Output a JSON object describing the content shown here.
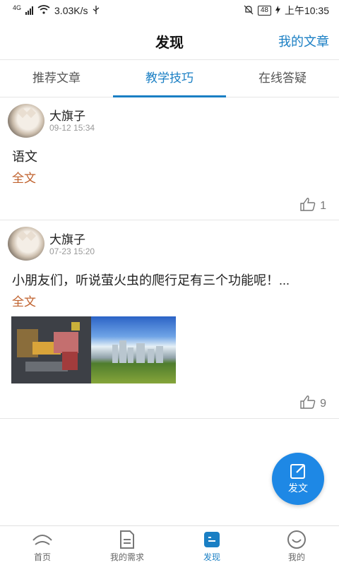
{
  "status_bar": {
    "network": "4G",
    "speed": "3.03K/s",
    "battery": "48",
    "time": "上午10:35"
  },
  "header": {
    "title": "发现",
    "action": "我的文章"
  },
  "tabs": [
    {
      "label": "推荐文章",
      "active": false
    },
    {
      "label": "教学技巧",
      "active": true
    },
    {
      "label": "在线答疑",
      "active": false
    }
  ],
  "posts": [
    {
      "author": "大旗子",
      "time": "09-12 15:34",
      "content": "语文",
      "full_text_label": "全文",
      "likes": "1"
    },
    {
      "author": "大旗子",
      "time": "07-23 15:20",
      "content": "小朋友们，听说萤火虫的爬行足有三个功能呢！...",
      "full_text_label": "全文",
      "likes": "9"
    }
  ],
  "fab": {
    "label": "发文"
  },
  "bottom_nav": [
    {
      "label": "首页",
      "icon": "home-icon"
    },
    {
      "label": "我的需求",
      "icon": "document-icon"
    },
    {
      "label": "发现",
      "icon": "discover-icon",
      "active": true
    },
    {
      "label": "我的",
      "icon": "smile-icon"
    }
  ],
  "colors": {
    "accent": "#1a7fc4",
    "full_text": "#c0622e",
    "fab": "#1e88e5"
  }
}
